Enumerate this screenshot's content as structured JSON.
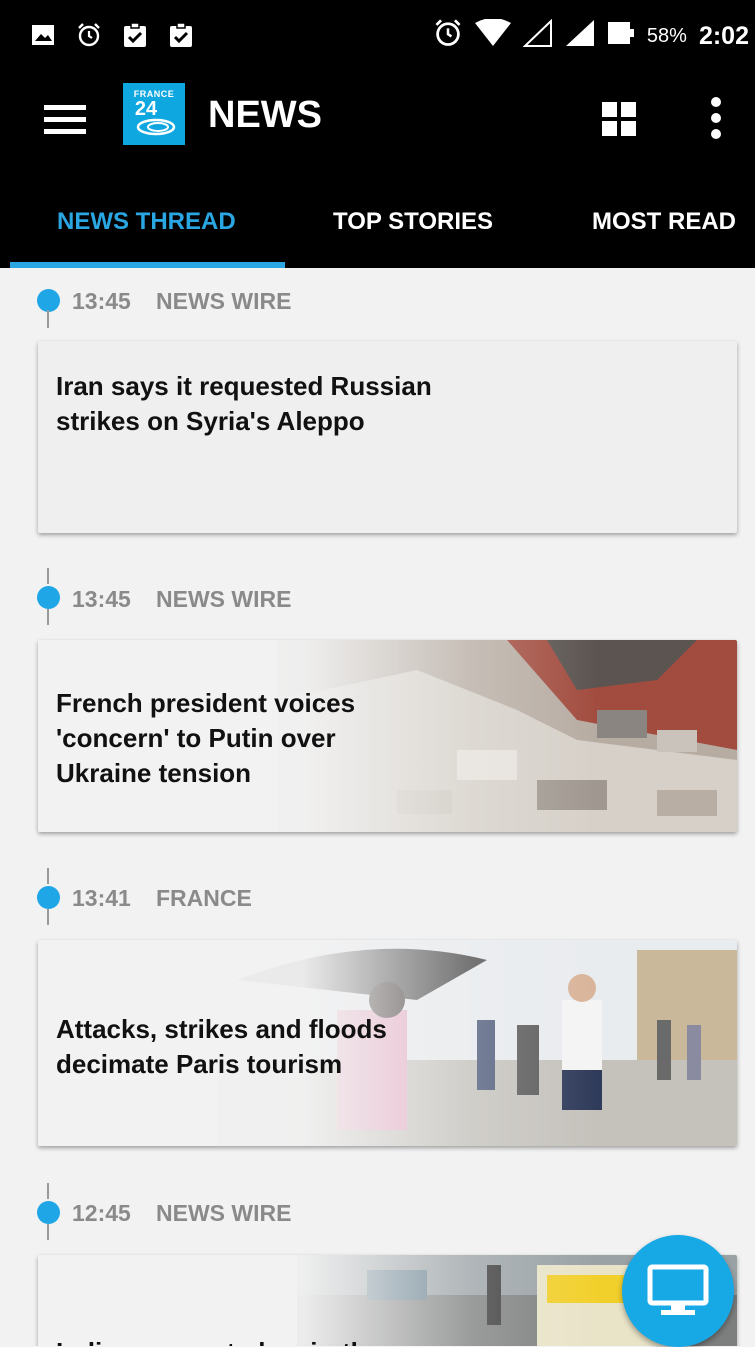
{
  "status_bar": {
    "battery_percent": "58%",
    "time": "2:02",
    "icons": [
      "image-icon",
      "alarm-icon",
      "clipboard-check-icon",
      "clipboard-check-icon",
      "alarm-icon",
      "wifi-icon",
      "signal-icon",
      "signal-icon",
      "battery-icon"
    ]
  },
  "app_bar": {
    "title": "NEWS",
    "logo_line1": "FRANCE",
    "logo_line2": "24"
  },
  "tabs": [
    {
      "label": "NEWS THREAD",
      "active": true
    },
    {
      "label": "TOP STORIES",
      "active": false
    },
    {
      "label": "MOST READ",
      "active": false
    }
  ],
  "feed": {
    "items": [
      {
        "time": "13:45",
        "category": "NEWS WIRE",
        "title": "Iran says it requested Russian strikes on Syria's Aleppo"
      },
      {
        "time": "13:45",
        "category": "NEWS WIRE",
        "title": "French president voices 'concern' to Putin over Ukraine tension"
      },
      {
        "time": "13:41",
        "category": "FRANCE",
        "title": "Attacks, strikes and floods decimate Paris tourism"
      },
      {
        "time": "12:45",
        "category": "NEWS WIRE",
        "title": "India cows get glow-in-the-"
      }
    ]
  },
  "colors": {
    "accent": "#2aa6e3",
    "background": "#f2f2f2",
    "bar": "#000000"
  }
}
